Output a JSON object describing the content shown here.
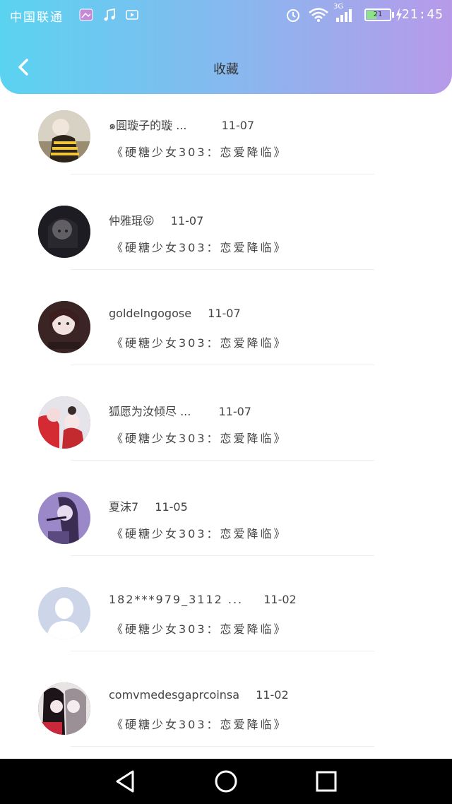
{
  "status_bar": {
    "carrier": "中国联通",
    "time": "21:45",
    "network": "3G",
    "battery": "21"
  },
  "header": {
    "title": "收藏"
  },
  "items": [
    {
      "name": "๑圓璇子的璇 ...",
      "date": "11-07",
      "subtitle": "《硬糖少女303：恋爱降临》"
    },
    {
      "name": "仲雅琨😝",
      "date": "11-07",
      "subtitle": "《硬糖少女303：恋爱降临》"
    },
    {
      "name": "goldelngogose",
      "date": "11-07",
      "subtitle": "《硬糖少女303：恋爱降临》"
    },
    {
      "name": "狐愿为汝倾尽 ...",
      "date": "11-07",
      "subtitle": "《硬糖少女303：恋爱降临》"
    },
    {
      "name": "夏沫7",
      "date": "11-05",
      "subtitle": "《硬糖少女303：恋爱降临》"
    },
    {
      "name": "182***979_3112 ...",
      "date": "11-02",
      "subtitle": "《硬糖少女303：恋爱降临》"
    },
    {
      "name": "comvmedesgaprcoinsa",
      "date": "11-02",
      "subtitle": "《硬糖少女303：恋爱降临》"
    }
  ],
  "avatars": [
    {
      "icon": "avatar-photo",
      "color": "#b9a98a"
    },
    {
      "icon": "avatar-photo",
      "color": "#2a2a30"
    },
    {
      "icon": "avatar-photo",
      "color": "#5a3a3a"
    },
    {
      "icon": "avatar-photo",
      "color": "#c8333a"
    },
    {
      "icon": "avatar-photo",
      "color": "#8d7bbf"
    },
    {
      "icon": "default-avatar-icon",
      "color": "#cfd6e8"
    },
    {
      "icon": "avatar-photo",
      "color": "#3c2a2e"
    }
  ]
}
